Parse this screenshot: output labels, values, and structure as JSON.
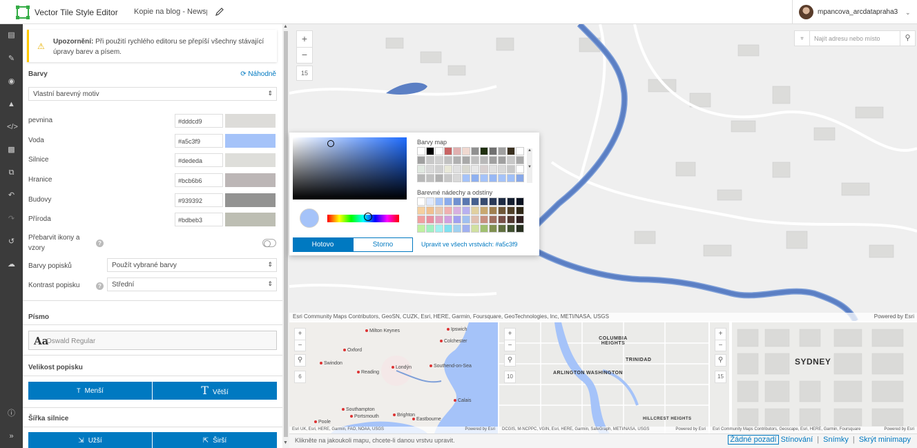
{
  "header": {
    "app_title": "Vector Tile Style Editor",
    "doc_title": "Kopie na blog - Newspa",
    "username": "mpancova_arcdatapraha3"
  },
  "toolbar": {
    "items": [
      "layers-icon",
      "style-icon",
      "eye-icon",
      "shapes-icon",
      "code-icon",
      "save-icon",
      "copy-icon",
      "undo-icon",
      "redo-icon",
      "history-icon",
      "upload-icon",
      "info-icon",
      "collapse-icon"
    ]
  },
  "panel": {
    "warning": {
      "title": "Upozornění:",
      "text": "Při použití rychlého editoru se přepíší všechny stávající úpravy barev a písem."
    },
    "colors_title": "Barvy",
    "random_label": "Náhodně",
    "theme_select": "Vlastní barevný motiv",
    "color_rows": [
      {
        "label": "pevnina",
        "hex": "#dddcd9",
        "color": "#dddcd9"
      },
      {
        "label": "Voda",
        "hex": "#a5c3f9",
        "color": "#a5c3f9"
      },
      {
        "label": "Silnice",
        "hex": "#dededa",
        "color": "#dededa"
      },
      {
        "label": "Hranice",
        "hex": "#bcb6b6",
        "color": "#bcb6b6"
      },
      {
        "label": "Budovy",
        "hex": "#939392",
        "color": "#939392"
      },
      {
        "label": "Příroda",
        "hex": "#bdbeb3",
        "color": "#bdbeb3"
      }
    ],
    "recolor_icons_label": "Přebarvit ikony a vzory",
    "label_colors_label": "Barvy popisků",
    "label_colors_value": "Použít vybrané barvy",
    "label_contrast_label": "Kontrast popisku",
    "label_contrast_value": "Střední",
    "font_title": "Písmo",
    "font_sample": "Aa",
    "font_name": "Oswald Regular",
    "label_size_title": "Velikost popisku",
    "smaller_label": "Menší",
    "larger_label": "Větší",
    "road_width_title": "Šířka silnice",
    "narrower_label": "Užší",
    "wider_label": "Širší"
  },
  "map": {
    "zoom_level": "15",
    "search_placeholder": "Najít adresu nebo místo",
    "attribution": "Esri Community Maps Contributors, GeoSN, CUZK, Esri, HERE, Garmin, Foursquare, GeoTechnologies, Inc, METI/NASA, USGS",
    "powered_by": "Powered by Esri"
  },
  "picker": {
    "map_colors_label": "Barvy map",
    "shades_label": "Barevné nádechy a odstíny",
    "done_label": "Hotovo",
    "cancel_label": "Storno",
    "apply_link": "Upravit ve všech vrstvách: #a5c3f9",
    "selected_color": "#a5c3f9",
    "map_colors": [
      "#ffffff",
      "#000000",
      "#ffffff",
      "#c86464",
      "#e0b0b0",
      "#f0d8d0",
      "#909090",
      "#203010",
      "#707070",
      "#a0a0a0",
      "#3a3020",
      "#ffffff",
      "#a0a0a0",
      "#c8c8c8",
      "#d0d0d0",
      "#c0c0c0",
      "#b0b0b0",
      "#a8a8a8",
      "#c0c0c0",
      "#b8b8b8",
      "#a0a0a0",
      "#a0a0a0",
      "#c8c8c8",
      "#a8a8a8",
      "#e0e8e0",
      "#d8d8d8",
      "#d0d0d0",
      "#e8e8d8",
      "#e0e0e0",
      "#d8d8d0",
      "#e8e8e8",
      "#d8d0d0",
      "#e0e0e0",
      "#d8d8d8",
      "#c8c8c8",
      "#ffffff",
      "#b8b8b8",
      "#c0c0c0",
      "#b0b0b0",
      "#c8c8c8",
      "#d8d8d8",
      "#a5c3f9",
      "#8fb0f0",
      "#a5c3f9",
      "#98b8f4",
      "#a5c3f9",
      "#a0c0f8",
      "#88a8e8"
    ],
    "shade_colors": [
      "#ffffff",
      "#dfe9fd",
      "#a5c3f9",
      "#8aabec",
      "#7090d0",
      "#5a78b0",
      "#46608f",
      "#384c70",
      "#2a3a58",
      "#1e2c44",
      "#141e30",
      "#0a1220",
      "#f5d0a0",
      "#f0c090",
      "#e8c8b0",
      "#f0b0b0",
      "#d8b0e0",
      "#b8b0f0",
      "#e0d0a0",
      "#c8a870",
      "#a08050",
      "#705838",
      "#504028",
      "#302818",
      "#f0a0a0",
      "#e890a0",
      "#e0a0c0",
      "#d0a0e0",
      "#a0a0f0",
      "#a0c0f0",
      "#e0c0b0",
      "#c89080",
      "#a07060",
      "#785048",
      "#503830",
      "#302020",
      "#c0f0a0",
      "#a0f0c0",
      "#a0f0f0",
      "#80e0f0",
      "#a0d0f0",
      "#a0b0f0",
      "#d0e0a0",
      "#a0c070",
      "#809050",
      "#607040",
      "#405030",
      "#283020"
    ]
  },
  "minimaps": {
    "london": {
      "cities": [
        "Milton Keynes",
        "Ipswich",
        "Colchester",
        "Oxford",
        "Swindon",
        "Reading",
        "Londýn",
        "Southend-on-Sea",
        "Calais",
        "Southampton",
        "Portsmouth",
        "Brighton",
        "Eastbourne",
        "Poole"
      ],
      "zoom": "6",
      "attribution": "Esri UK, Esri, HERE, Garmin, FAO, NOAA, USGS",
      "powered_by": "Powered by Esri"
    },
    "washington": {
      "labels": [
        "COLUMBIA HEIGHTS",
        "TRINIDAD",
        "ARLINGTON",
        "WASHINGTON",
        "HILLCREST HEIGHTS"
      ],
      "zoom": "10",
      "attribution": "DCGIS, M-NCPPC, VGIN, Esri, HERE, Garmin, SafeGraph, METI/NASA, USGS",
      "powered_by": "Powered by Esri"
    },
    "sydney": {
      "labels": [
        "SYDNEY"
      ],
      "zoom": "15",
      "attribution": "Esri Community Maps Contributors, Geoscape, Esri, HERE, Garmin, Foursquare",
      "powered_by": "Powered by Esri"
    }
  },
  "footer": {
    "hint": "Klikněte na jakoukoli mapu, chcete-li danou vrstvu upravit.",
    "no_background": "Žádné pozadí",
    "hillshade": "Stínování",
    "snapshots": "Snímky",
    "hide_minimaps": "Skrýt minimapy"
  }
}
